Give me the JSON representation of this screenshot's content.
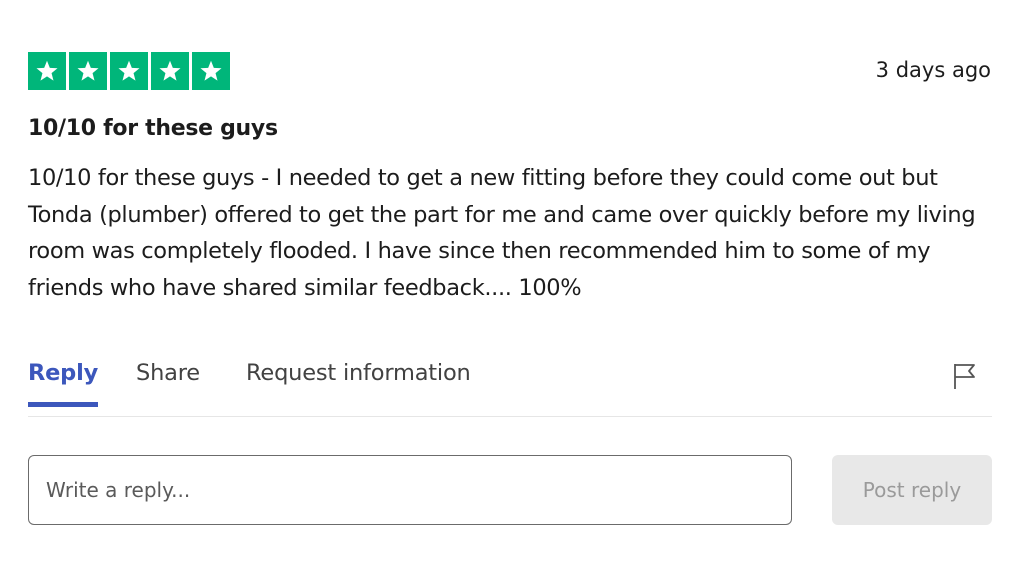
{
  "review": {
    "rating": 5,
    "rating_max": 5,
    "star_color": "#00b67a",
    "date": "3 days ago",
    "title": "10/10 for these guys",
    "body": "10/10 for these guys - I needed to get a new fitting before they could come out but Tonda (plumber) offered to get the part for me and came over quickly before my living room was completely flooded. I have since then recommended him to some of my friends who have shared similar feedback.... 100%"
  },
  "actions": {
    "tabs": [
      {
        "label": "Reply",
        "active": true
      },
      {
        "label": "Share",
        "active": false
      },
      {
        "label": "Request information",
        "active": false
      }
    ],
    "accent_color": "#3c57bc",
    "flag_icon": "flag-icon"
  },
  "reply_form": {
    "placeholder": "Write a reply...",
    "value": "",
    "post_label": "Post reply"
  }
}
